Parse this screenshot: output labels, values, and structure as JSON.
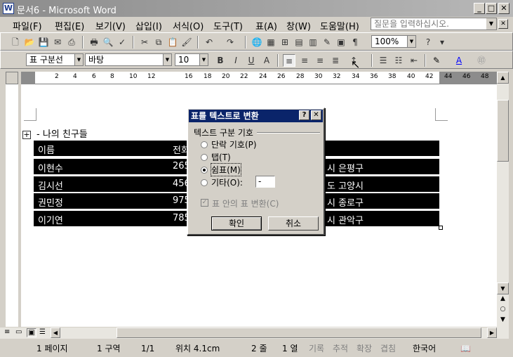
{
  "window": {
    "title": "문서6 - Microsoft Word",
    "icon": "W"
  },
  "menu": [
    "파일(F)",
    "편집(E)",
    "보기(V)",
    "삽입(I)",
    "서식(O)",
    "도구(T)",
    "표(A)",
    "창(W)",
    "도움말(H)"
  ],
  "ask_box": {
    "placeholder": "질문을 입력하십시오."
  },
  "toolbar": {
    "zoom": "100%",
    "style": "표 구분선",
    "font": "바탕",
    "size": "10"
  },
  "ruler_ticks": [
    "2",
    "4",
    "6",
    "8",
    "10",
    "12",
    "16",
    "18",
    "20",
    "22",
    "24",
    "26",
    "28",
    "30",
    "32",
    "34",
    "36",
    "38",
    "40",
    "42",
    "44",
    "46",
    "48"
  ],
  "document": {
    "heading": "- 나의 친구들",
    "table_rows": [
      {
        "name": "이름",
        "phone": "전화",
        "addr": ""
      },
      {
        "name": "이현수",
        "phone": "265",
        "addr": "시 은평구"
      },
      {
        "name": "김시선",
        "phone": "456",
        "addr": "도 고양시"
      },
      {
        "name": "권민정",
        "phone": "975",
        "addr": "시 종로구"
      },
      {
        "name": "이기연",
        "phone": "785",
        "addr": "시 관악구"
      }
    ]
  },
  "dialog": {
    "title": "표를 텍스트로 변환",
    "group": "텍스트 구분 기호",
    "options": [
      {
        "label": "단락 기호(P)",
        "checked": false
      },
      {
        "label": "탭(T)",
        "checked": false
      },
      {
        "label": "쉼표(M)",
        "checked": true
      },
      {
        "label": "기타(O):",
        "checked": false
      }
    ],
    "other_value": "-",
    "nested_checkbox": "표 안의 표 변환(C)",
    "ok": "확인",
    "cancel": "취소"
  },
  "status": {
    "page": "1 페이지",
    "section": "1 구역",
    "pages": "1/1",
    "position": "위치 4.1cm",
    "line": "2 줄",
    "col": "1 열",
    "rec": "기록",
    "trk": "추적",
    "ext": "확장",
    "ovr": "겹침",
    "lang": "한국어"
  }
}
